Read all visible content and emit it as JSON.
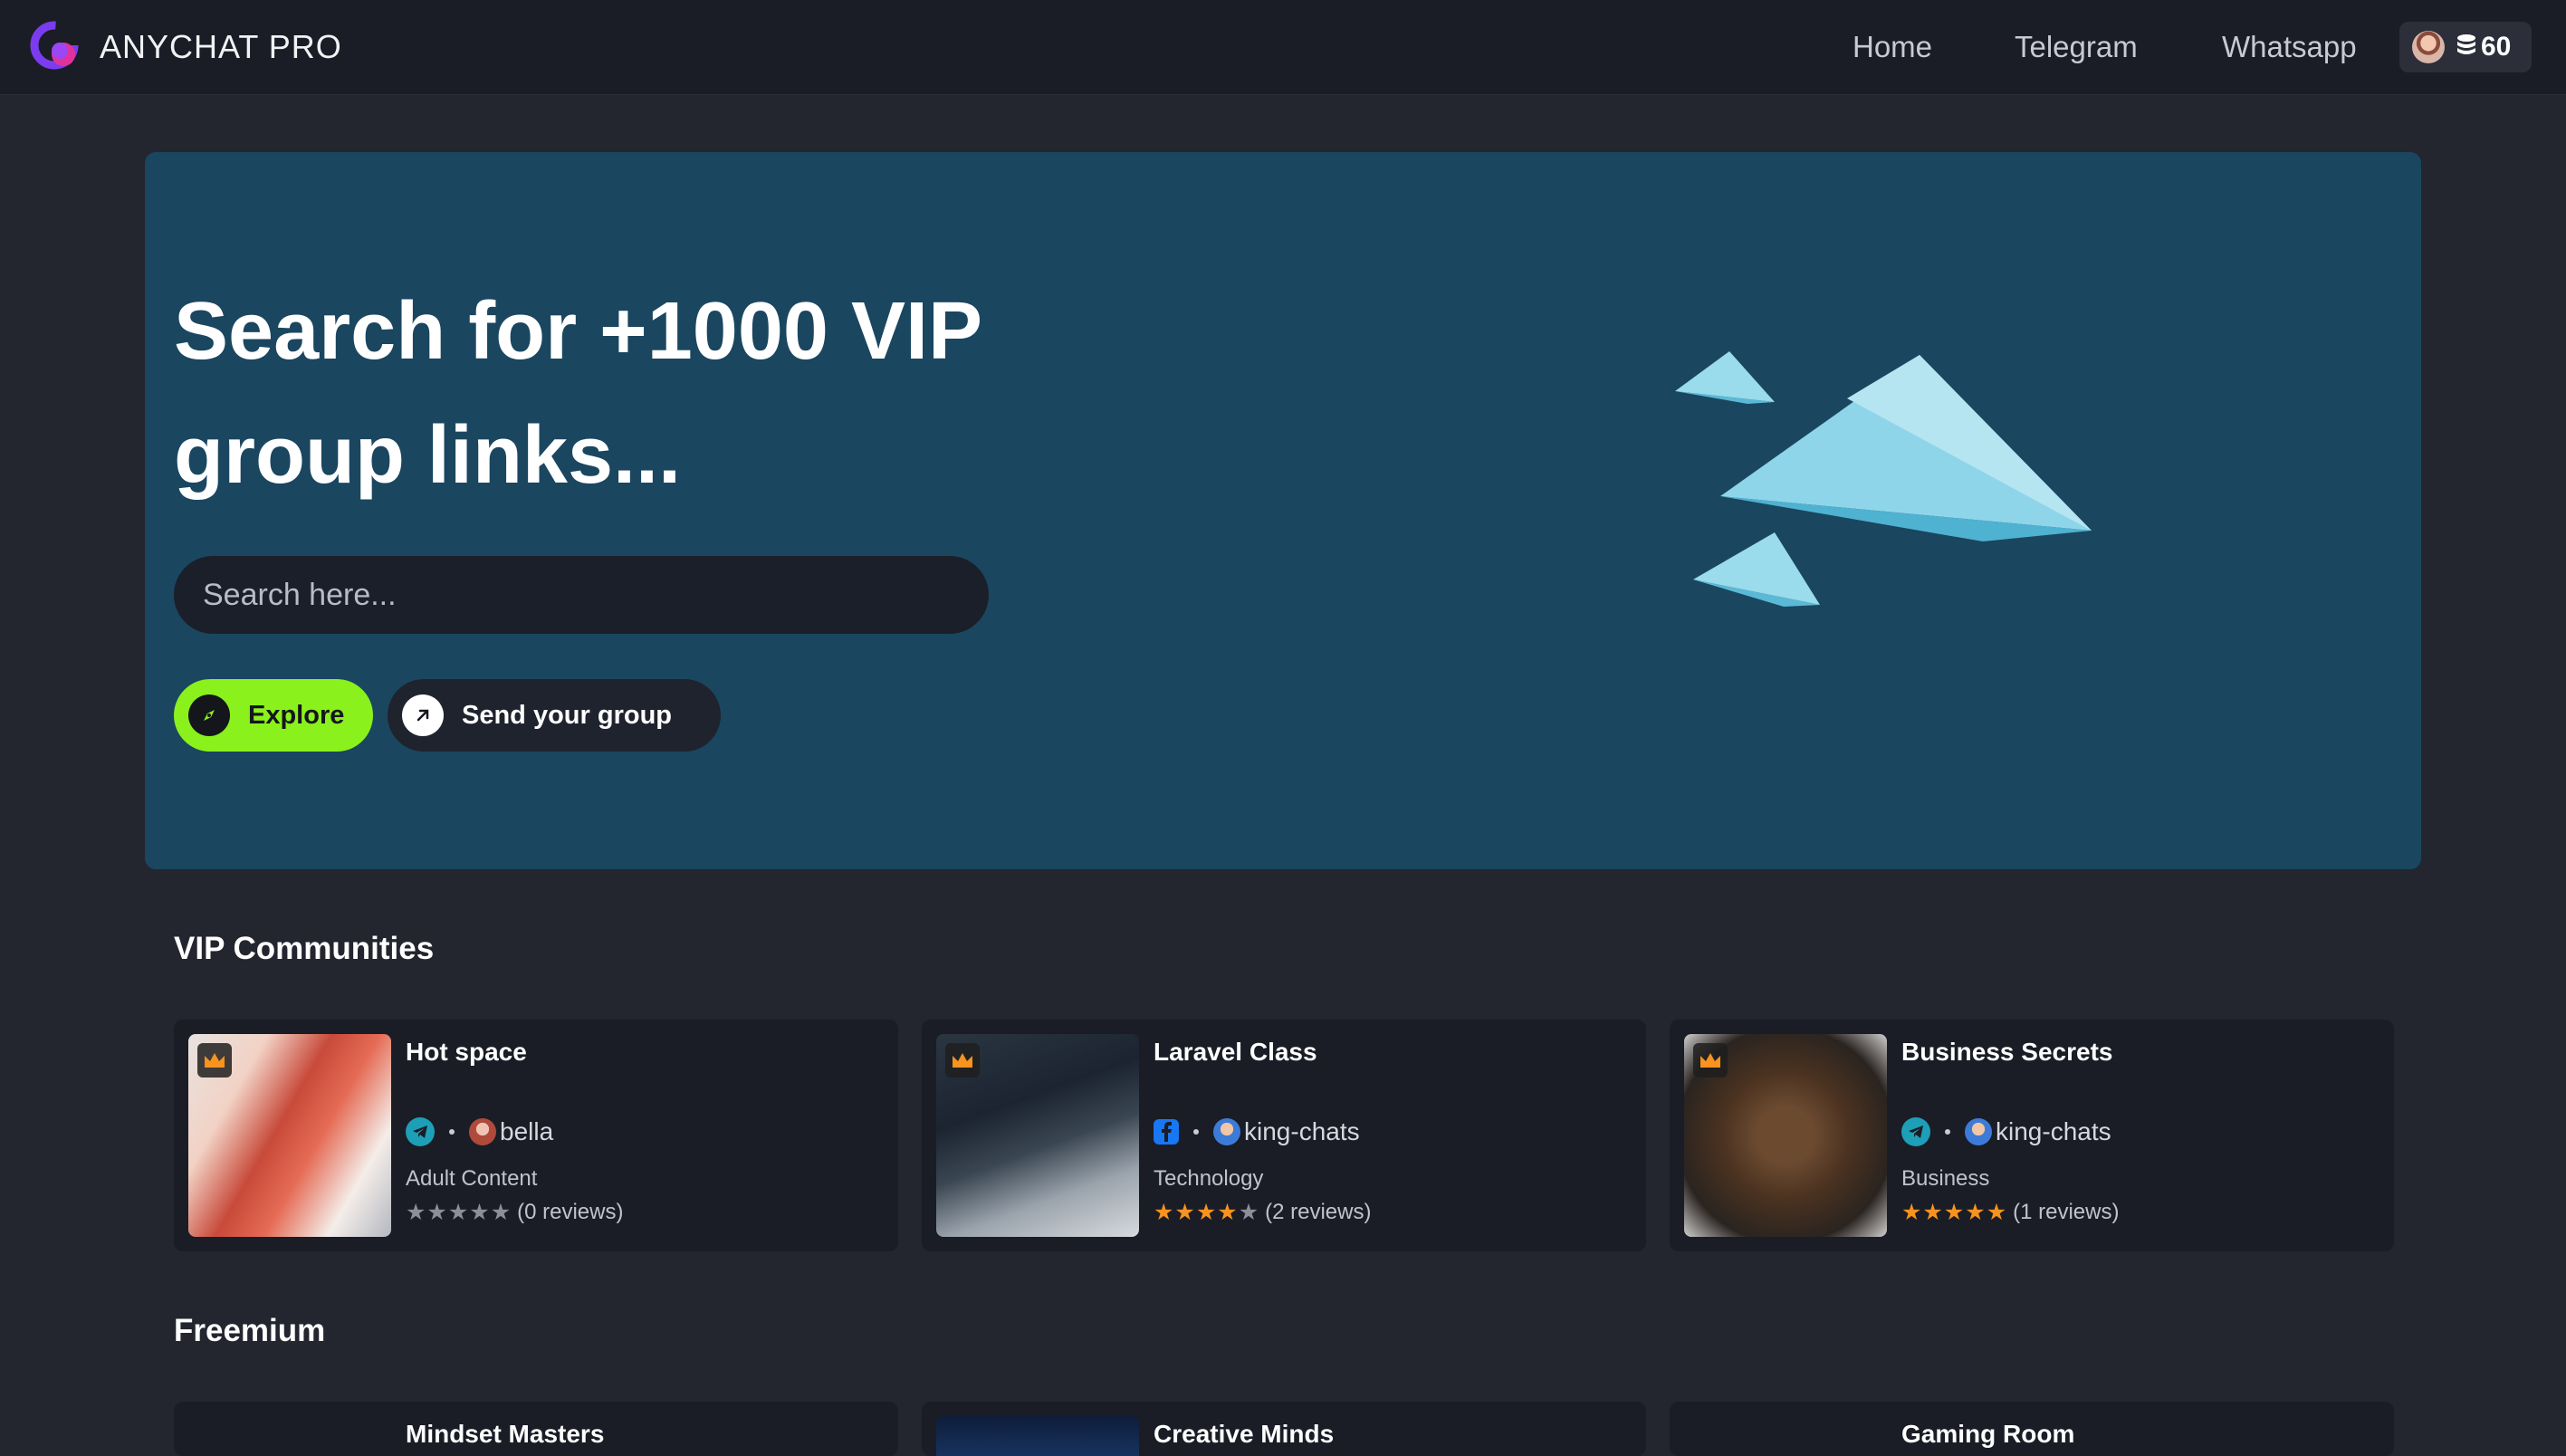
{
  "brand": {
    "name": "ANYCHAT PRO"
  },
  "nav": [
    {
      "label": "Home"
    },
    {
      "label": "Telegram"
    },
    {
      "label": "Whatsapp"
    }
  ],
  "wallet": {
    "icon": "coins-icon",
    "balance": "60"
  },
  "hero": {
    "title": "Search for +1000 VIP group links...",
    "search_placeholder": "Search here...",
    "explore_label": "Explore",
    "send_label": "Send your group"
  },
  "vip": {
    "heading": "VIP Communities",
    "cards": [
      {
        "title": "Hot space",
        "platform": "telegram",
        "owner": "bella",
        "category": "Adult Content",
        "rating": 0,
        "reviews": "(0 reviews)"
      },
      {
        "title": "Laravel Class",
        "platform": "facebook",
        "owner": "king-chats",
        "category": "Technology",
        "rating": 4,
        "reviews": "(2 reviews)"
      },
      {
        "title": "Business Secrets",
        "platform": "telegram",
        "owner": "king-chats",
        "category": "Business",
        "rating": 5,
        "reviews": "(1 reviews)"
      }
    ]
  },
  "freemium": {
    "heading": "Freemium",
    "cards": [
      {
        "title": "Mindset Masters"
      },
      {
        "title": "Creative Minds"
      },
      {
        "title": "Gaming Room"
      }
    ]
  },
  "colors": {
    "page_bg": "#23252f",
    "nav_bg": "#1a1d26",
    "hero_bg": "#1a4660",
    "explore_accent": "#8bf11c",
    "star_filled": "#f7931e",
    "star_empty": "#8c8f98",
    "telegram": "#1e9fb8",
    "facebook": "#1877f2"
  }
}
